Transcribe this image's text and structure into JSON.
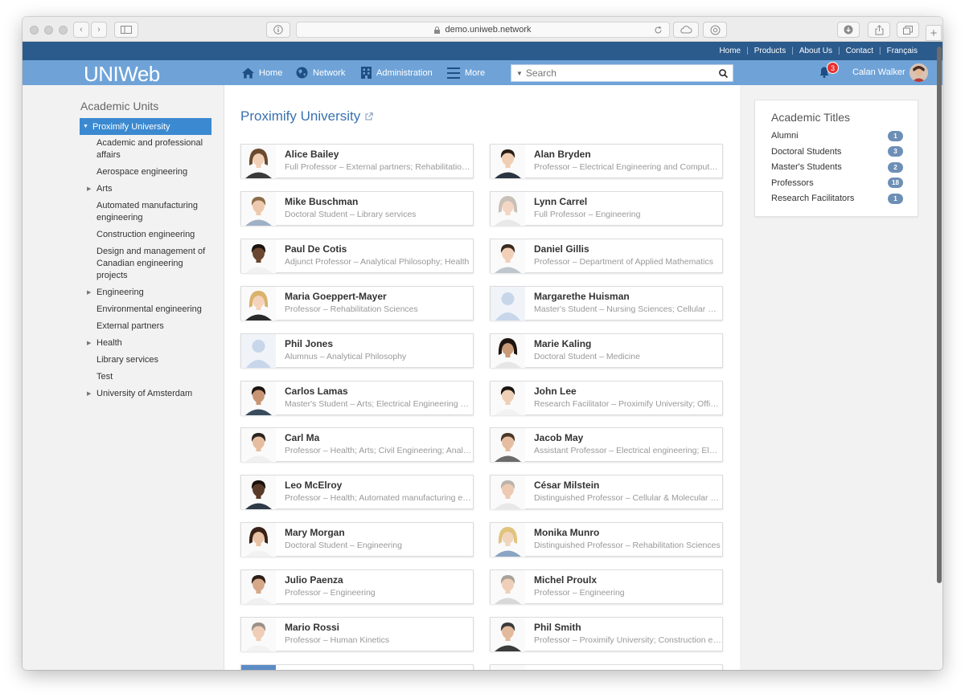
{
  "browser": {
    "url": "demo.uniweb.network"
  },
  "topbar": {
    "links": [
      "Home",
      "Products",
      "About Us",
      "Contact",
      "Français"
    ]
  },
  "navbar": {
    "logo": "UNIWeb",
    "items": [
      "Home",
      "Network",
      "Administration",
      "More"
    ],
    "search_placeholder": "Search",
    "notifications": "3",
    "user_name": "Calan Walker"
  },
  "sidebar": {
    "heading": "Academic Units",
    "active_unit": "Proximify University",
    "units": [
      {
        "label": "Academic and professional affairs",
        "expandable": false
      },
      {
        "label": "Aerospace engineering",
        "expandable": false
      },
      {
        "label": "Arts",
        "expandable": true
      },
      {
        "label": "Automated manufacturing engineering",
        "expandable": false
      },
      {
        "label": "Construction engineering",
        "expandable": false
      },
      {
        "label": "Design and management of Canadian engineering projects",
        "expandable": false
      },
      {
        "label": "Engineering",
        "expandable": true
      },
      {
        "label": "Environmental engineering",
        "expandable": false
      },
      {
        "label": "External partners",
        "expandable": false
      },
      {
        "label": "Health",
        "expandable": true
      },
      {
        "label": "Library services",
        "expandable": false
      },
      {
        "label": "Test",
        "expandable": false
      },
      {
        "label": "University of Amsterdam",
        "expandable": true
      }
    ]
  },
  "main": {
    "title": "Proximify University",
    "people": [
      {
        "name": "Alice Bailey",
        "role": "Full Professor – External partners; Rehabilitation Sciences",
        "photo": "f1"
      },
      {
        "name": "Alan Bryden",
        "role": "Professor – Electrical Engineering and Computer Science",
        "photo": "m1"
      },
      {
        "name": "Mike Buschman",
        "role": "Doctoral Student – Library services",
        "photo": "m2"
      },
      {
        "name": "Lynn Carrel",
        "role": "Full Professor – Engineering",
        "photo": "f2"
      },
      {
        "name": "Paul De Cotis",
        "role": "Adjunct Professor – Analytical Philosophy; Health",
        "photo": "m3"
      },
      {
        "name": "Daniel Gillis",
        "role": "Professor – Department of Applied Mathematics",
        "photo": "m4"
      },
      {
        "name": "Maria Goeppert-Mayer",
        "role": "Professor – Rehabilitation Sciences",
        "photo": "f3"
      },
      {
        "name": "Margarethe Huisman",
        "role": "Master's Student – Nursing Sciences; Cellular & Molecular Medicine",
        "photo": "none"
      },
      {
        "name": "Phil Jones",
        "role": "Alumnus – Analytical Philosophy",
        "photo": "none"
      },
      {
        "name": "Marie Kaling",
        "role": "Doctoral Student – Medicine",
        "photo": "f4"
      },
      {
        "name": "Carlos Lamas",
        "role": "Master's Student – Arts; Electrical Engineering and Computer Science",
        "photo": "m5"
      },
      {
        "name": "John Lee",
        "role": "Research Facilitator – Proximify University; Office of Research",
        "photo": "m6"
      },
      {
        "name": "Carl Ma",
        "role": "Professor – Health; Arts; Civil Engineering; Analytical Philosophy",
        "photo": "m7"
      },
      {
        "name": "Jacob May",
        "role": "Assistant Professor – Electrical engineering; Electronics",
        "photo": "m8"
      },
      {
        "name": "Leo McElroy",
        "role": "Professor – Health; Automated manufacturing engineering",
        "photo": "m9"
      },
      {
        "name": "César Milstein",
        "role": "Distinguished Professor – Cellular & Molecular Medicine",
        "photo": "m10"
      },
      {
        "name": "Mary Morgan",
        "role": "Doctoral Student – Engineering",
        "photo": "f5"
      },
      {
        "name": "Monika Munro",
        "role": "Distinguished Professor – Rehabilitation Sciences",
        "photo": "f6"
      },
      {
        "name": "Julio Paenza",
        "role": "Professor – Engineering",
        "photo": "m11"
      },
      {
        "name": "Michel Proulx",
        "role": "Professor – Engineering",
        "photo": "m12"
      },
      {
        "name": "Mario Rossi",
        "role": "Professor – Human Kinetics",
        "photo": "m13"
      },
      {
        "name": "Phil Smith",
        "role": "Professor – Proximify University; Construction engineering",
        "photo": "m14"
      }
    ]
  },
  "titles": {
    "heading": "Academic Titles",
    "items": [
      {
        "label": "Alumni",
        "count": "1"
      },
      {
        "label": "Doctoral Students",
        "count": "3"
      },
      {
        "label": "Master's Students",
        "count": "2"
      },
      {
        "label": "Professors",
        "count": "18"
      },
      {
        "label": "Research Facilitators",
        "count": "1"
      }
    ]
  },
  "colors": {
    "brand_dark": "#2b5a8c",
    "brand_light": "#6fa3d8",
    "active": "#3b89d0",
    "badge": "#6d8fb6"
  }
}
